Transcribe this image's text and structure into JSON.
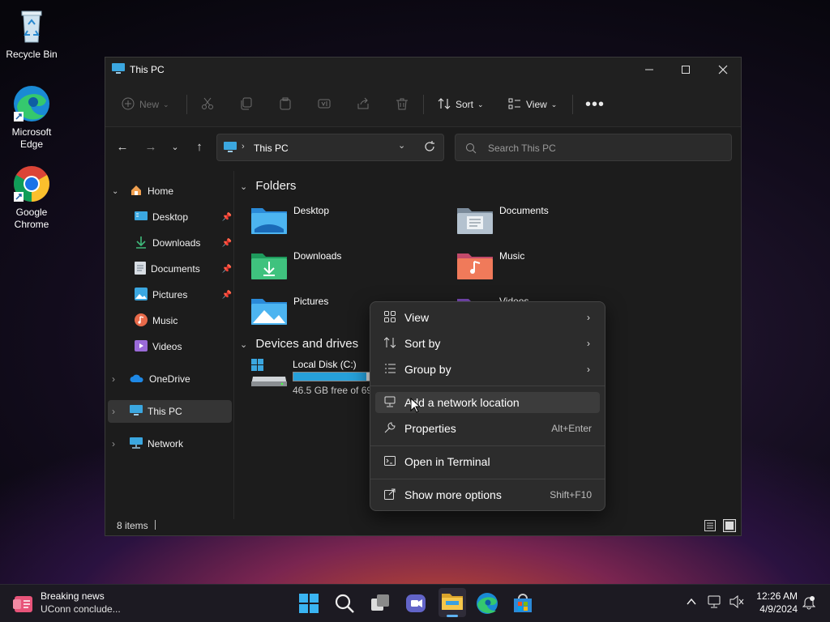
{
  "desktop": {
    "icons": [
      {
        "label": "Recycle Bin"
      },
      {
        "label": "Microsoft Edge"
      },
      {
        "label": "Google Chrome"
      }
    ]
  },
  "window": {
    "title": "This PC",
    "toolbar": {
      "new_label": "New",
      "sort_label": "Sort",
      "view_label": "View"
    },
    "address": {
      "location": "This PC"
    },
    "search": {
      "placeholder": "Search This PC"
    },
    "sidebar": {
      "items": [
        {
          "label": "Home"
        },
        {
          "label": "Desktop"
        },
        {
          "label": "Downloads"
        },
        {
          "label": "Documents"
        },
        {
          "label": "Pictures"
        },
        {
          "label": "Music"
        },
        {
          "label": "Videos"
        },
        {
          "label": "OneDrive"
        },
        {
          "label": "This PC"
        },
        {
          "label": "Network"
        }
      ]
    },
    "content": {
      "folders_header": "Folders",
      "folders": [
        {
          "label": "Desktop"
        },
        {
          "label": "Documents"
        },
        {
          "label": "Downloads"
        },
        {
          "label": "Music"
        },
        {
          "label": "Pictures"
        },
        {
          "label": "Videos"
        }
      ],
      "drives_header": "Devices and drives",
      "drive": {
        "name": "Local Disk (C:)",
        "free": "46.5 GB free of 69.",
        "used_fraction": 0.65
      }
    },
    "status": {
      "items": "8 items"
    }
  },
  "context_menu": {
    "items": [
      {
        "label": "View"
      },
      {
        "label": "Sort by"
      },
      {
        "label": "Group by"
      },
      {
        "label": "Add a network location"
      },
      {
        "label": "Properties",
        "shortcut": "Alt+Enter"
      },
      {
        "label": "Open in Terminal"
      },
      {
        "label": "Show more options",
        "shortcut": "Shift+F10"
      }
    ]
  },
  "taskbar": {
    "news_title": "Breaking news",
    "news_subtitle": "UConn conclude...",
    "time": "12:26 AM",
    "date": "4/9/2024"
  },
  "colors": {
    "accent": "#0078d4",
    "window_bg": "#1c1c1c",
    "menu_bg": "#2c2c2c",
    "drive_bar": "#26a0da"
  }
}
